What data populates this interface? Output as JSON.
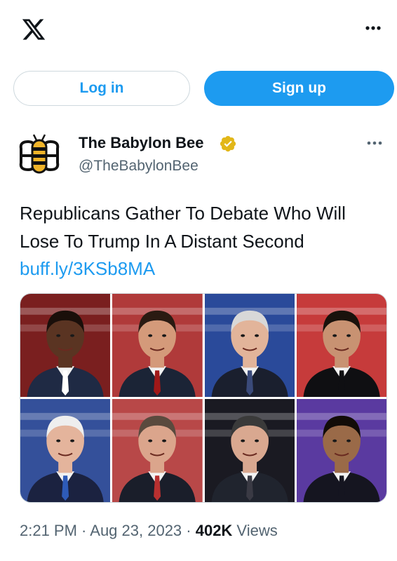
{
  "header": {
    "logo_icon": "x-logo-icon",
    "more_icon": "more-horizontal-icon"
  },
  "auth": {
    "login_label": "Log in",
    "signup_label": "Sign up"
  },
  "post": {
    "author": {
      "name": "The Babylon Bee",
      "handle": "@TheBabylonBee",
      "avatar_icon": "bee-logo-icon",
      "verified_icon": "verified-badge-icon"
    },
    "more_icon": "more-horizontal-icon",
    "text": "Republicans Gather To Debate Who Will Lose To Trump In A Distant Second",
    "link": "buff.ly/3KSb8MA",
    "media": [
      {
        "bg": "#7a1f1f",
        "skin": "#5a3422",
        "hair": "#1a0f0a",
        "suit": "#1f2a44",
        "tie": "#ffffff"
      },
      {
        "bg": "#b03a3a",
        "skin": "#d49a7a",
        "hair": "#2a1a12",
        "suit": "#1b2436",
        "tie": "#a01818"
      },
      {
        "bg": "#2a4a9a",
        "skin": "#e2b49a",
        "hair": "#d8d8d8",
        "suit": "#1a1f2e",
        "tie": "#3a4a7a"
      },
      {
        "bg": "#c63b3b",
        "skin": "#c89272",
        "hair": "#1a120c",
        "suit": "#0f0f12",
        "tie": "#0f0f12"
      },
      {
        "bg": "#34509a",
        "skin": "#e4b49c",
        "hair": "#eeeeee",
        "suit": "#1b2240",
        "tie": "#2e5bb8"
      },
      {
        "bg": "#b84848",
        "skin": "#dba58c",
        "hair": "#5a4a3e",
        "suit": "#1a1e2a",
        "tie": "#b83030"
      },
      {
        "bg": "#1a1a22",
        "skin": "#d9a890",
        "hair": "#3a3a3a",
        "suit": "#20242e",
        "tie": "#3a3a44"
      },
      {
        "bg": "#5a3aa0",
        "skin": "#9a6a48",
        "hair": "#120c08",
        "suit": "#151520",
        "tie": "#151520"
      }
    ],
    "timestamp": "2:21 PM · Aug 23, 2023 · ",
    "views_count": "402K",
    "views_label": " Views"
  }
}
